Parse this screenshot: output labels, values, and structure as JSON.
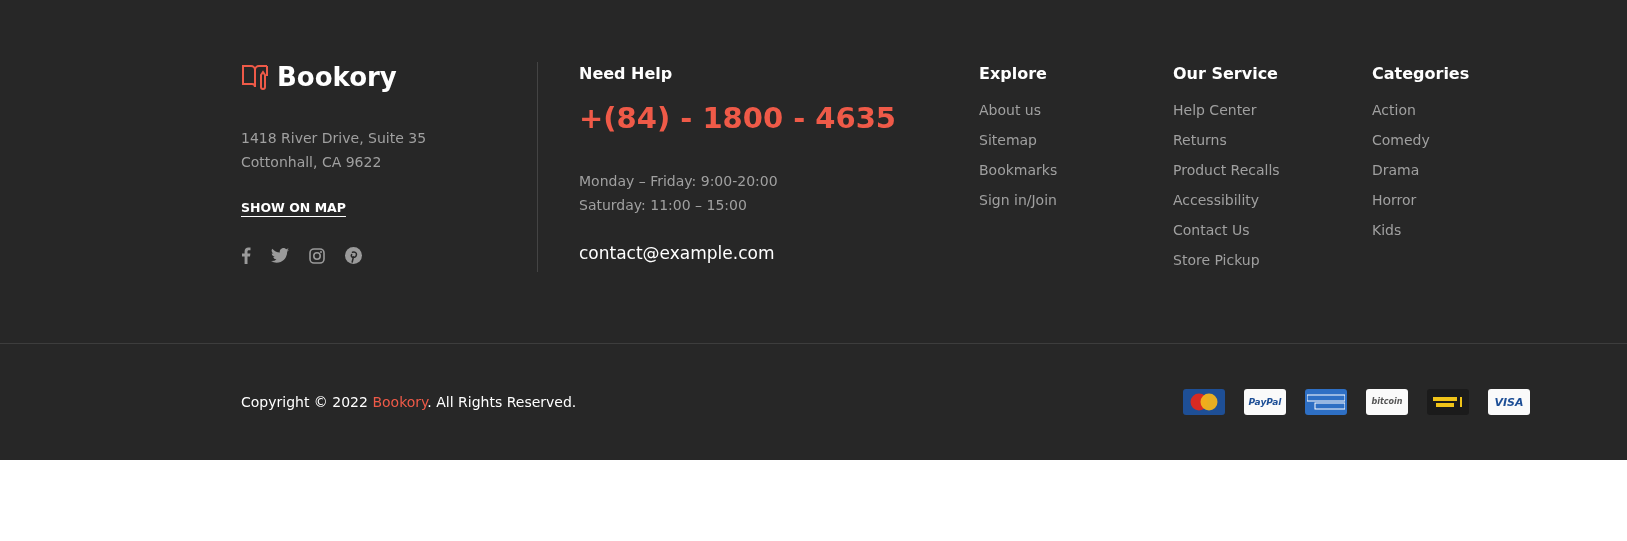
{
  "brand": {
    "name": "Bookory",
    "address": [
      "1418 River Drive, Suite 35",
      "Cottonhall, CA 9622"
    ],
    "map_link": "SHOW ON MAP",
    "social": [
      {
        "kind": "facebook"
      },
      {
        "kind": "twitter"
      },
      {
        "kind": "instagram"
      },
      {
        "kind": "pinterest"
      }
    ]
  },
  "help": {
    "title": "Need Help",
    "phone": "+(84) - 1800 - 4635",
    "hours": [
      "Monday – Friday: 9:00-20:00",
      "Saturday: 11:00 – 15:00"
    ],
    "email": "contact@example.com"
  },
  "link_columns": [
    {
      "title": "Explore",
      "links": [
        "About us",
        "Sitemap",
        "Bookmarks",
        "Sign in/Join"
      ]
    },
    {
      "title": "Our Service",
      "links": [
        "Help Center",
        "Returns",
        "Product Recalls",
        "Accessibility",
        "Contact Us",
        "Store Pickup"
      ]
    },
    {
      "title": "Categories",
      "links": [
        "Action",
        "Comedy",
        "Drama",
        "Horror",
        "Kids"
      ]
    }
  ],
  "copyright": {
    "before": "Copyright © 2022 ",
    "link": "Bookory",
    "after": ". All Rights Reserved."
  },
  "payments": [
    {
      "kind": "mastercard"
    },
    {
      "kind": "paypal",
      "label": "PayPal"
    },
    {
      "kind": "amex"
    },
    {
      "kind": "bitcoin",
      "label": "bitcoin"
    },
    {
      "kind": "westernunion"
    },
    {
      "kind": "visa",
      "label": "VISA"
    }
  ]
}
